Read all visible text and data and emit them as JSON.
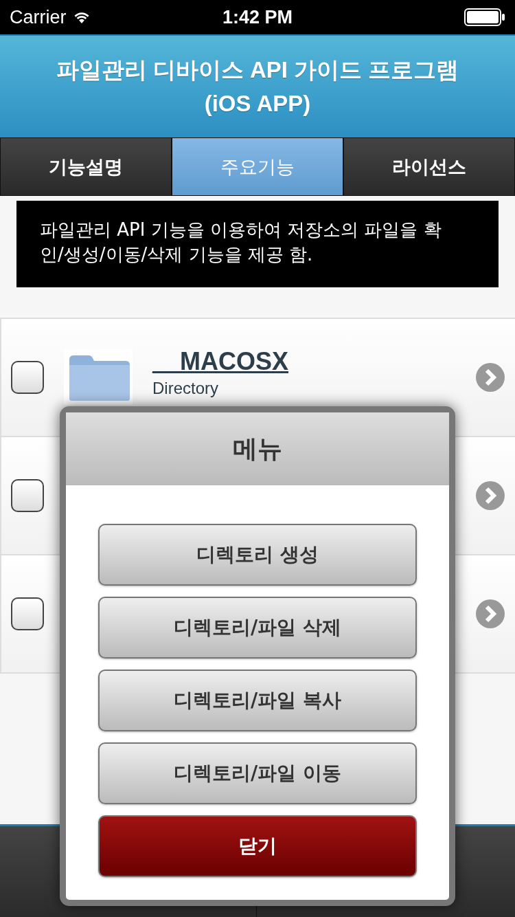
{
  "status_bar": {
    "carrier": "Carrier",
    "time": "1:42 PM"
  },
  "header": {
    "title": "파일관리 디바이스 API 가이드 프로그램\n(iOS APP)"
  },
  "tabs": [
    {
      "label": "기능설명",
      "selected": false
    },
    {
      "label": "주요기능",
      "selected": true
    },
    {
      "label": "라이선스",
      "selected": false
    }
  ],
  "description": "파일관리 API 기능을 이용하여 저장소의 파일을 확인/생성/이동/삭제 기능을 제공 함.",
  "files": [
    {
      "name": "__MACOSX",
      "type": "Directory",
      "checked": false
    },
    {
      "checked": false
    },
    {
      "checked": false
    }
  ],
  "menu": {
    "title": "메뉴",
    "buttons": [
      {
        "label": "디렉토리 생성",
        "kind": "action"
      },
      {
        "label": "디렉토리/파일 삭제",
        "kind": "action"
      },
      {
        "label": "디렉토리/파일 복사",
        "kind": "action"
      },
      {
        "label": "디렉토리/파일 이동",
        "kind": "action"
      },
      {
        "label": "닫기",
        "kind": "close"
      }
    ]
  }
}
